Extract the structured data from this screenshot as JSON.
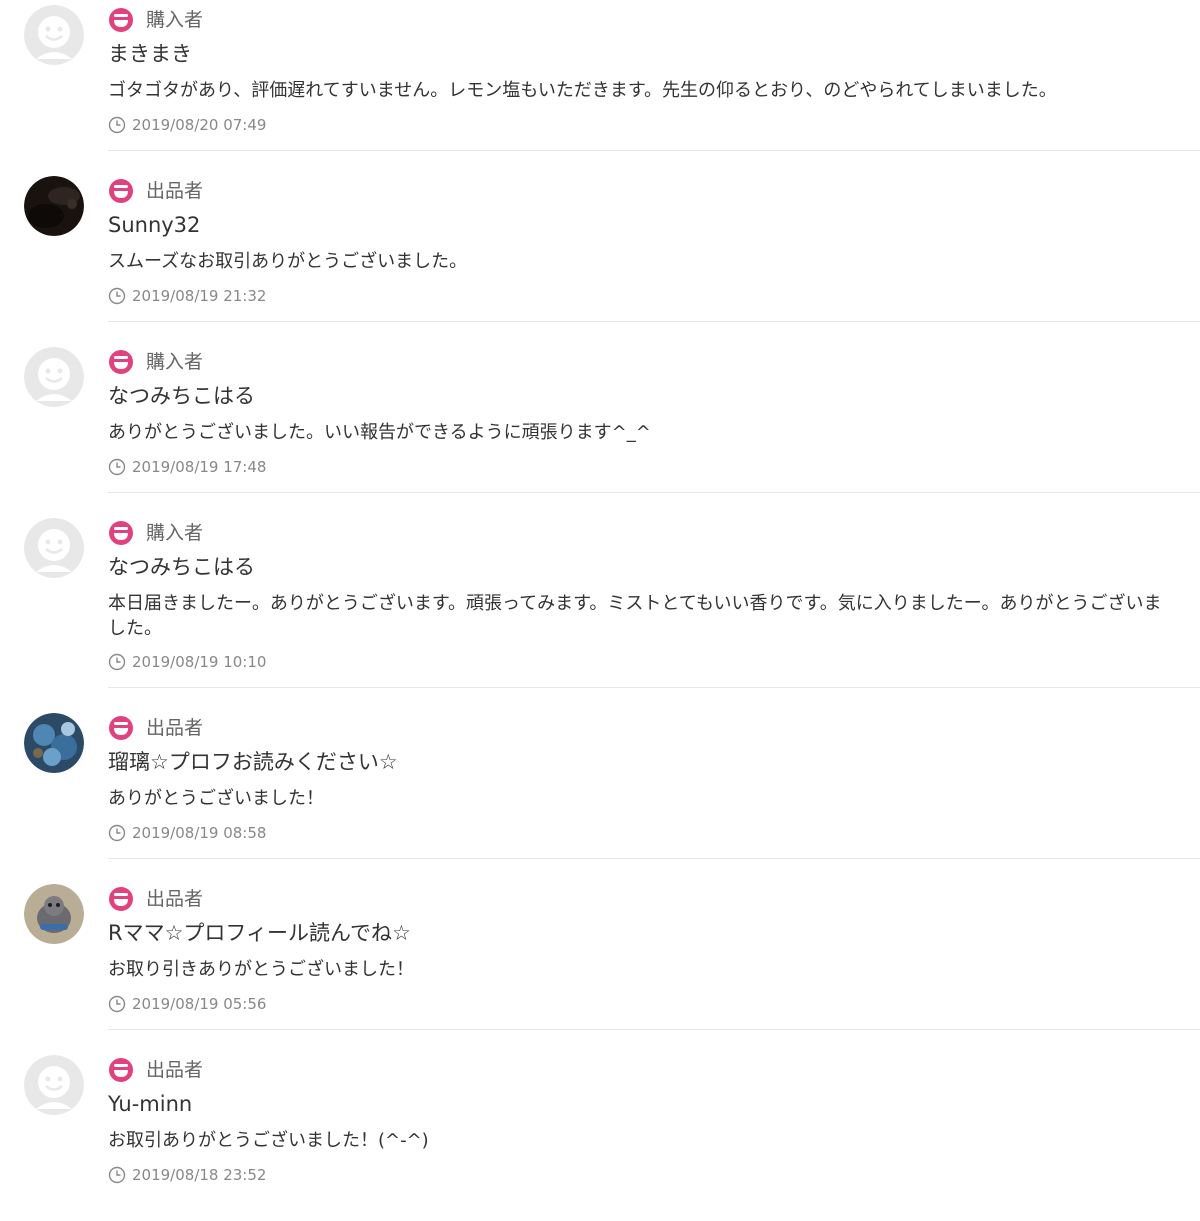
{
  "colors": {
    "role_icon": "#e0427f",
    "divider": "#e6e6e6",
    "default_avatar_bg": "#e8e8e8",
    "default_avatar_face": "#ffffff"
  },
  "reviews": [
    {
      "role": "購入者",
      "role_icon": "smiley-face-icon",
      "avatar": "default-avatar",
      "username": "まきまき",
      "comment": "ゴタゴタがあり、評価遅れてすいません。レモン塩もいただきます。先生の仰るとおり、のどやられてしまいました。",
      "timestamp": "2019/08/20 07:49"
    },
    {
      "role": "出品者",
      "role_icon": "smiley-face-icon",
      "avatar": "dark-photo-avatar",
      "username": "Sunny32",
      "comment": "スムーズなお取引ありがとうございました。",
      "timestamp": "2019/08/19 21:32"
    },
    {
      "role": "購入者",
      "role_icon": "smiley-face-icon",
      "avatar": "default-avatar",
      "username": "なつみちこはる",
      "comment": "ありがとうございました。いい報告ができるように頑張ります^_^",
      "timestamp": "2019/08/19 17:48"
    },
    {
      "role": "購入者",
      "role_icon": "smiley-face-icon",
      "avatar": "default-avatar",
      "username": "なつみちこはる",
      "comment": "本日届きましたー。ありがとうございます。頑張ってみます。ミストとてもいい香りです。気に入りましたー。ありがとうございました。",
      "timestamp": "2019/08/19 10:10"
    },
    {
      "role": "出品者",
      "role_icon": "smiley-face-icon",
      "avatar": "blue-photo-avatar",
      "username": "瑠璃☆プロフお読みください☆",
      "comment": "ありがとうございました！",
      "timestamp": "2019/08/19 08:58"
    },
    {
      "role": "出品者",
      "role_icon": "smiley-face-icon",
      "avatar": "plush-photo-avatar",
      "username": "Rママ☆プロフィール読んでね☆",
      "comment": "お取り引きありがとうございました！",
      "timestamp": "2019/08/19 05:56"
    },
    {
      "role": "出品者",
      "role_icon": "smiley-face-icon",
      "avatar": "default-avatar",
      "username": "Yu-minn",
      "comment": "お取引ありがとうございました！(^-^)",
      "timestamp": "2019/08/18 23:52"
    }
  ]
}
